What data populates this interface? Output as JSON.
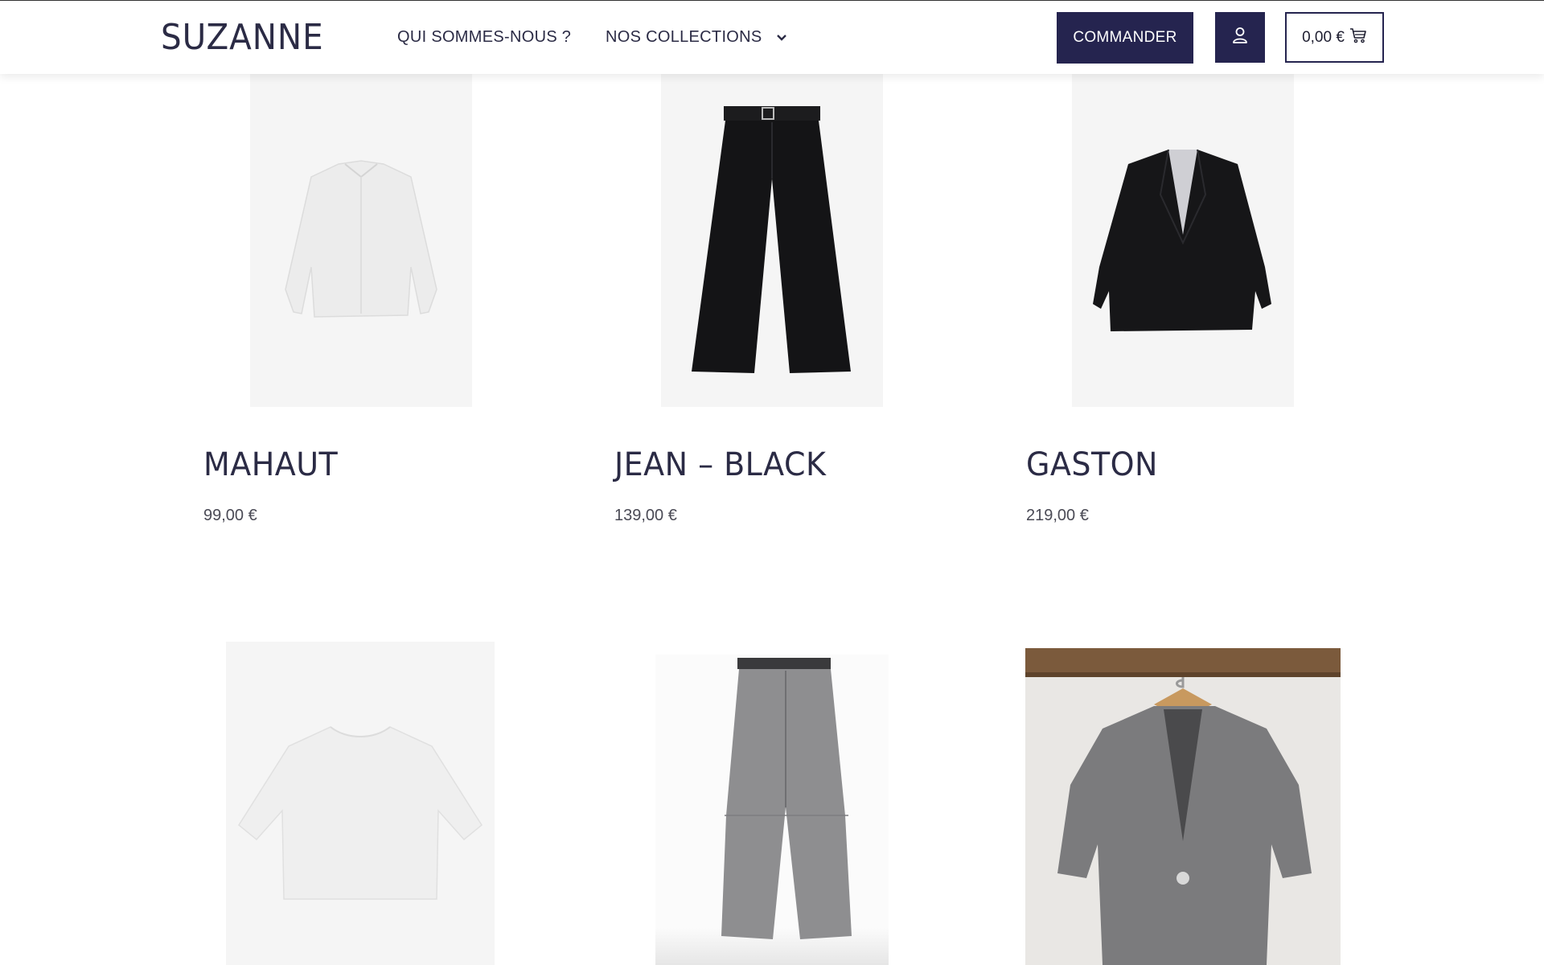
{
  "header": {
    "logo": "SUZANNE",
    "nav": {
      "about": "QUI SOMMES-NOUS ?",
      "collections": "NOS COLLECTIONS"
    },
    "order_button": "COMMANDER",
    "account_icon": "user-icon",
    "cart": {
      "total": "0,00 €",
      "icon": "cart-icon"
    }
  },
  "products": [
    {
      "name": "MAHAUT",
      "price": "99,00 €"
    },
    {
      "name": "JEAN – BLACK",
      "price": "139,00 €"
    },
    {
      "name": "GASTON",
      "price": "219,00 €"
    }
  ],
  "colors": {
    "brand": "#25244f",
    "text": "#2b2b45",
    "image_bg": "#f5f5f5"
  }
}
